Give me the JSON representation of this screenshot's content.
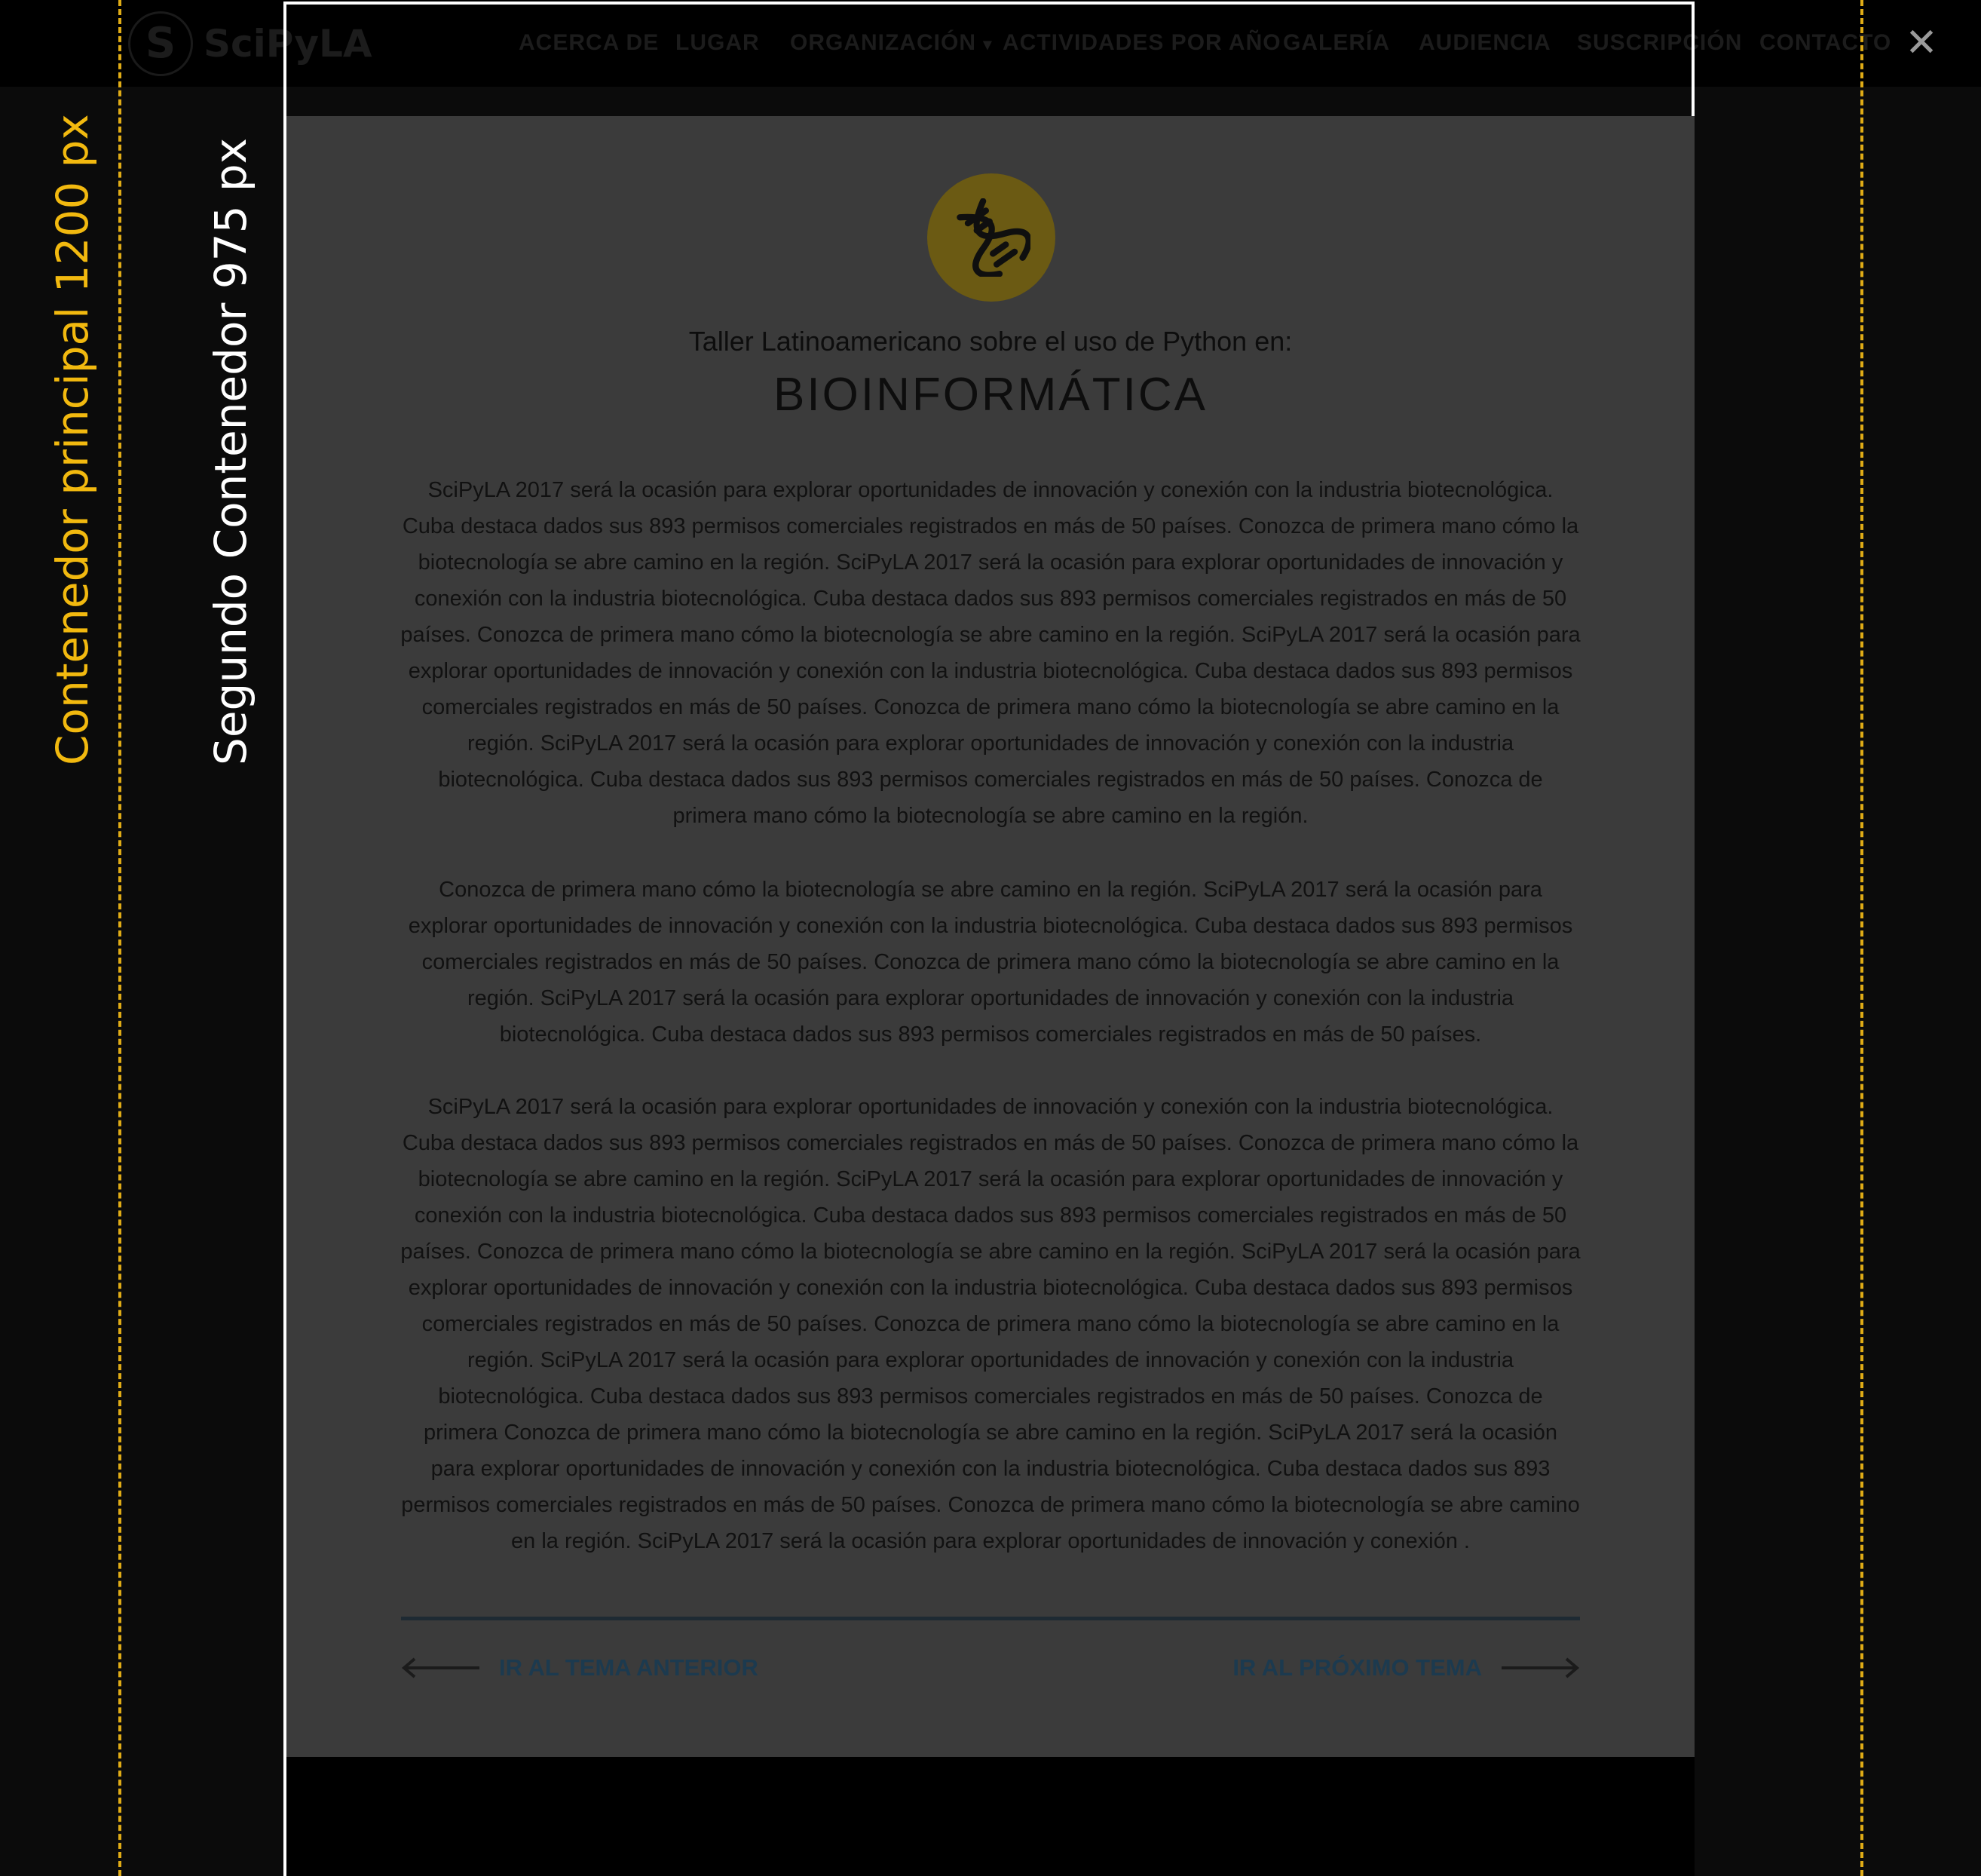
{
  "logo": {
    "mark": "S",
    "text": "SciPyLA"
  },
  "nav": {
    "items": [
      "ACERCA DE",
      "LUGAR",
      "ORGANIZACIÓN",
      "ACTIVIDADES POR AÑO",
      "GALERÍA",
      "AUDIENCIA",
      "SUSCRIPCIÓN",
      "CONTACTO"
    ],
    "dropdown_arrow": "▾"
  },
  "close_label": "✕",
  "annotations": {
    "main_container": "Contenedor principal 1200 px",
    "second_container": "Segundo Contenedor  975 px"
  },
  "content": {
    "subtitle": "Taller Latinoamericano sobre el uso de Python en:",
    "title": "BIOINFORMÁTICA",
    "paragraphs": [
      "SciPyLA 2017 será la ocasión para explorar oportunidades de innovación y conexión con la industria biotecnológica. Cuba  destaca dados sus 893 permisos comerciales registrados en más de 50 países. Conozca de primera mano cómo la biotecnología se abre camino en la región. SciPyLA 2017 será la ocasión para explorar oportunidades de innovación y conexión con la industria biotecnológica. Cuba destaca dados sus 893 permisos comerciales registrados en más de 50 países. Conozca de primera mano cómo la biotecnología se abre camino en la región. SciPyLA 2017 será la ocasión para explorar oportunidades de innovación y conexión con la industria biotecnológica. Cuba destaca dados sus 893 permisos comerciales registrados en más de 50 países. Conozca de primera mano cómo la biotecnología se abre camino en la región. SciPyLA 2017 será la ocasión para explorar oportunidades de innovación y conexión con la industria biotecnológica. Cuba destaca dados sus 893 permisos comerciales registrados en más de 50 países. Conozca de primera mano cómo la biotecnología se abre camino en la región.",
      "Conozca de primera mano cómo la biotecnología se abre camino en la región. SciPyLA 2017 será la ocasión para explorar oportunidades de innovación y conexión con la industria biotecnológica. Cuba destaca dados sus 893 permisos comerciales registrados en más de 50 países. Conozca de primera mano cómo la biotecnología se abre camino en la región. SciPyLA 2017 será la ocasión para explorar oportunidades de innovación y conexión con la industria biotecnológica. Cuba destaca dados sus 893 permisos comerciales registrados en más de 50 países.",
      "SciPyLA 2017 será la ocasión para explorar oportunidades de innovación y conexión con la industria biotecnológica. Cuba  destaca dados sus 893 permisos comerciales registrados en más de 50 países. Conozca de primera mano cómo la biotecnología se abre camino en la región. SciPyLA 2017 será la ocasión para explorar oportunidades de innovación y conexión con la industria biotecnológica. Cuba destaca dados sus 893 permisos comerciales registrados en más de 50 países. Conozca de primera mano cómo la biotecnología se abre camino en la región. SciPyLA 2017 será la ocasión para explorar oportunidades de innovación y conexión con la industria biotecnológica. Cuba destaca dados sus 893 permisos comerciales registrados en más de 50 países. Conozca de primera mano cómo la biotecnología se abre camino en la región. SciPyLA 2017 será la ocasión para explorar oportunidades de innovación y conexión con la industria biotecnológica. Cuba destaca dados sus 893 permisos comerciales registrados en más de 50 países. Conozca de primera Conozca de primera mano cómo la biotecnología se abre camino en la región. SciPyLA 2017 será la ocasión para explorar oportunidades de innovación y conexión con la industria biotecnológica. Cuba destaca dados sus 893 permisos comerciales registrados en más de 50 países. Conozca de primera mano cómo la biotecnología se abre camino en la región. SciPyLA 2017 será la ocasión para explorar oportunidades de innovación y conexión ."
    ],
    "prev_label": "IR AL TEMA ANTERIOR",
    "next_label": "IR AL PRÓXIMO TEMA"
  },
  "icons": {
    "close": "close-icon",
    "topic": "dna-icon",
    "prev": "arrow-left-icon",
    "next": "arrow-right-icon"
  },
  "colors": {
    "annotation_yellow": "#f2b90f",
    "overlay_background": "#0b0b0b",
    "content_background": "#3b3b3b",
    "icon_circle": "#6b5a13",
    "link_color": "#1c3a4f"
  }
}
